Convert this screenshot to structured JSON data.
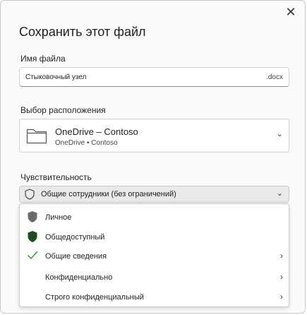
{
  "dialog": {
    "title": "Сохранить этот файл",
    "close_glyph": "✕"
  },
  "filename": {
    "label": "Имя файла",
    "value": "Стыковочный узел",
    "extension": ".docx"
  },
  "location": {
    "label": "Выбор расположения",
    "icon": "folder-icon",
    "name": "OneDrive – Contoso",
    "subtitle": "OneDrive • Contoso",
    "chevron": "⌄"
  },
  "sensitivity": {
    "label": "Чувствительность",
    "selected": "Общие сотрудники (без ограничений)",
    "icon": "shield-icon",
    "chevron": "⌄",
    "options": [
      {
        "label": "Личное",
        "icon": "shield-gray-icon",
        "submenu": false
      },
      {
        "label": "Общедоступный",
        "icon": "shield-green-icon",
        "submenu": false
      },
      {
        "label": "Общие сведения",
        "icon": "checkmark-icon",
        "submenu": true
      },
      {
        "label": "Конфиденциально",
        "icon": "",
        "submenu": true
      },
      {
        "label": "Строго конфиденциальный",
        "icon": "",
        "submenu": true
      }
    ],
    "submenu_glyph": "›"
  },
  "colors": {
    "shield_gray": "#6b6b6b",
    "shield_green": "#1e4d1e",
    "check_green": "#3a8a3a"
  }
}
